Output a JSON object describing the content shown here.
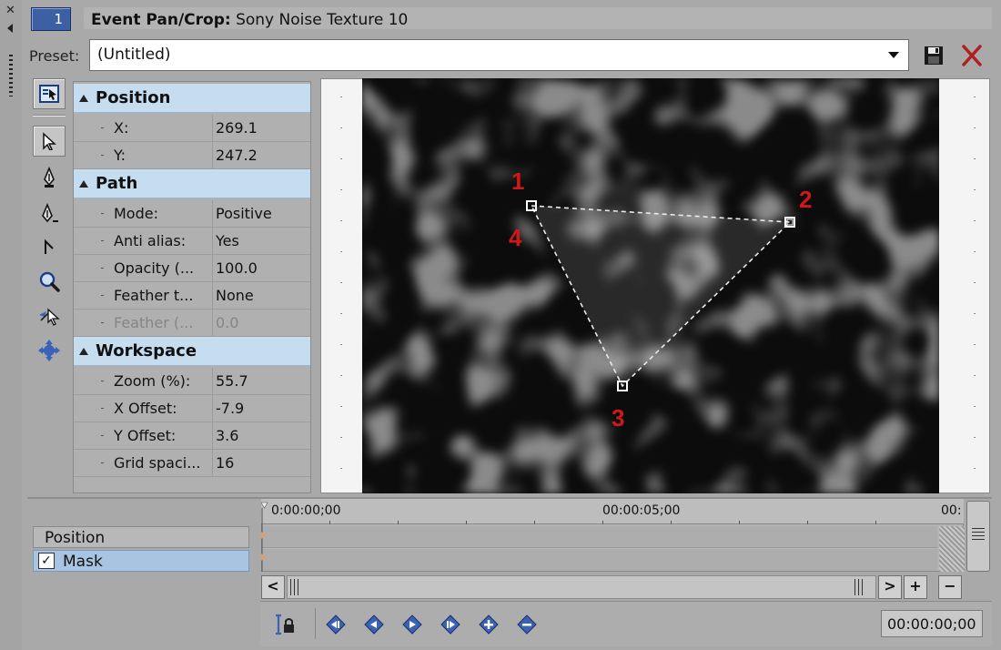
{
  "title_bar": {
    "event_number": "1",
    "window_label": "Event Pan/Crop:",
    "media_name": "Sony Noise Texture 10"
  },
  "preset": {
    "label": "Preset:",
    "value": "(Untitled)"
  },
  "tools": [
    {
      "icon": "show-properties-icon",
      "selected": true
    },
    {
      "icon": "normal-edit-pointer-icon",
      "selected": true
    },
    {
      "icon": "anchor-creation-pen-icon"
    },
    {
      "icon": "anchor-deletion-pen-icon"
    },
    {
      "icon": "split-tangent-icon"
    },
    {
      "icon": "zoom-icon"
    },
    {
      "icon": "enable-snapping-icon"
    },
    {
      "icon": "move-freely-icon"
    }
  ],
  "properties": {
    "position": {
      "title": "Position",
      "x_label": "X:",
      "x_value": "269.1",
      "y_label": "Y:",
      "y_value": "247.2"
    },
    "path": {
      "title": "Path",
      "mode_label": "Mode:",
      "mode_value": "Positive",
      "antialias_label": "Anti alias:",
      "antialias_value": "Yes",
      "opacity_label": "Opacity (...",
      "opacity_value": "100.0",
      "feather_type_label": "Feather t...",
      "feather_type_value": "None",
      "feather_pct_label": "Feather (...",
      "feather_pct_value": "0.0"
    },
    "workspace": {
      "title": "Workspace",
      "zoom_label": "Zoom (%):",
      "zoom_value": "55.7",
      "xoffset_label": "X Offset:",
      "xoffset_value": "-7.9",
      "yoffset_label": "Y Offset:",
      "yoffset_value": "3.6",
      "grid_label": "Grid spaci...",
      "grid_value": "16"
    }
  },
  "mask_points": {
    "p1": "1",
    "p2": "2",
    "p3": "3",
    "p4": "4"
  },
  "timeline": {
    "tracks": {
      "position": "Position",
      "mask": "Mask",
      "mask_checked": "✓"
    },
    "tc_start": "0:00:00;00",
    "tc_mid": "00:00:05;00",
    "tc_end": "00:",
    "scroll_left": "<",
    "scroll_right": ">",
    "zoom_in": "+",
    "zoom_out": "−"
  },
  "keyframe_controls": [
    "lock-envelopes-icon",
    "first-keyframe-icon",
    "previous-keyframe-icon",
    "next-keyframe-icon",
    "last-keyframe-icon",
    "add-keyframe-icon",
    "delete-keyframe-icon"
  ],
  "cursor_timecode": "00:00:00;00",
  "colors": {
    "category_header": "#c6ddf0",
    "selected_track": "#a9c4e0",
    "point_labels": "#d01818",
    "keyframe_button": "#3a63b8"
  }
}
